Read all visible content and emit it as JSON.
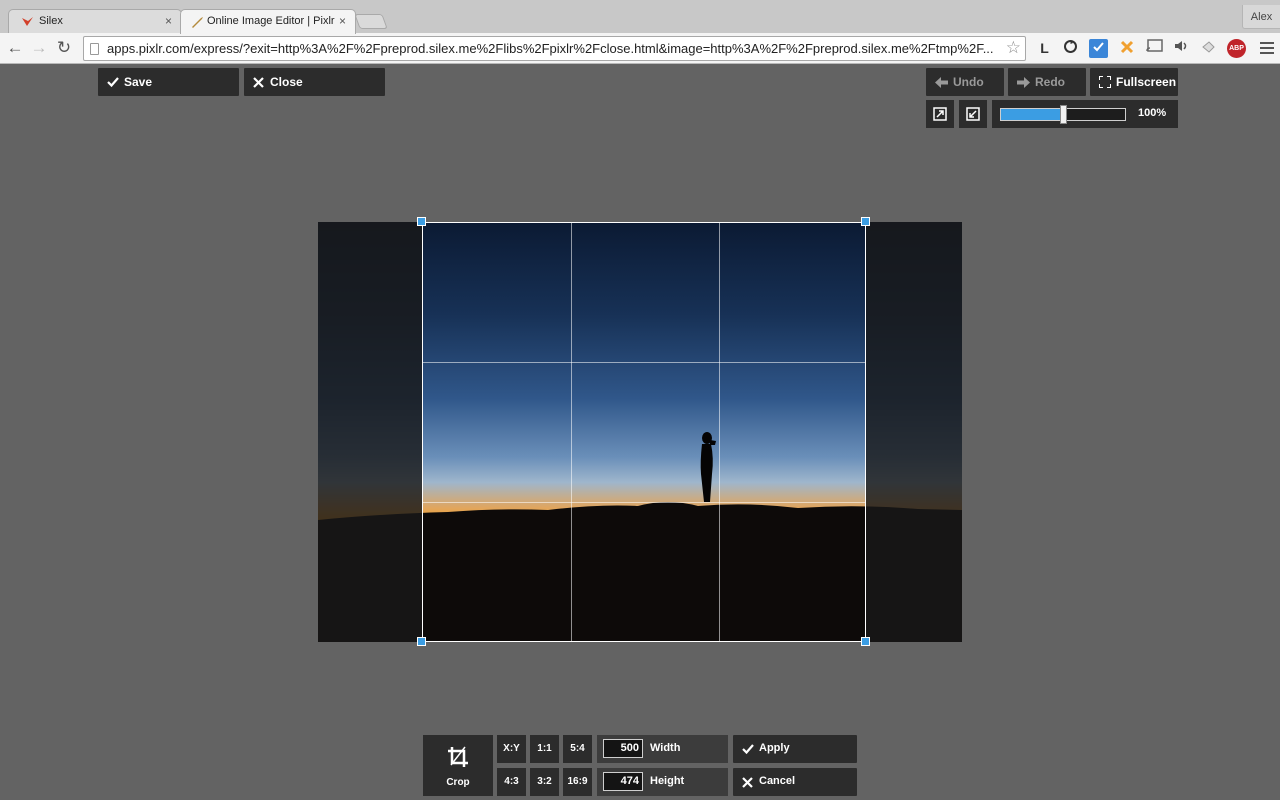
{
  "browser": {
    "tabs": [
      {
        "title": "Silex",
        "close": "×"
      },
      {
        "title": "Online Image Editor | Pixlr",
        "close": "×"
      }
    ],
    "profile": "Alex",
    "url": "apps.pixlr.com/express/?exit=http%3A%2F%2Fpreprod.silex.me%2Flibs%2Fpixlr%2Fclose.html&image=http%3A%2F%2Fpreprod.silex.me%2Ftmp%2F...",
    "nav": {
      "back": "←",
      "forward": "→",
      "reload": "↻"
    },
    "bookmark_star": "☆",
    "extensions": [
      "L",
      "sync-icon",
      "check-icon",
      "puzzle-icon",
      "cast-icon",
      "sound-icon",
      "pin-icon",
      "ABP"
    ]
  },
  "editor": {
    "save_label": "Save",
    "close_label": "Close",
    "undo_label": "Undo",
    "redo_label": "Redo",
    "fullscreen_label": "Fullscreen",
    "zoom_value": "100%",
    "zoom_fraction": 0.5
  },
  "crop_bar": {
    "tool_label": "Crop",
    "ratios_top": [
      "X:Y",
      "1:1",
      "5:4"
    ],
    "ratios_bottom": [
      "4:3",
      "3:2",
      "16:9"
    ],
    "width_value": "500",
    "width_label": "Width",
    "height_value": "474",
    "height_label": "Height",
    "apply_label": "Apply",
    "cancel_label": "Cancel"
  },
  "colors": {
    "accent": "#3b9de3",
    "panel": "#2c2c2c",
    "workspace": "#636363"
  }
}
